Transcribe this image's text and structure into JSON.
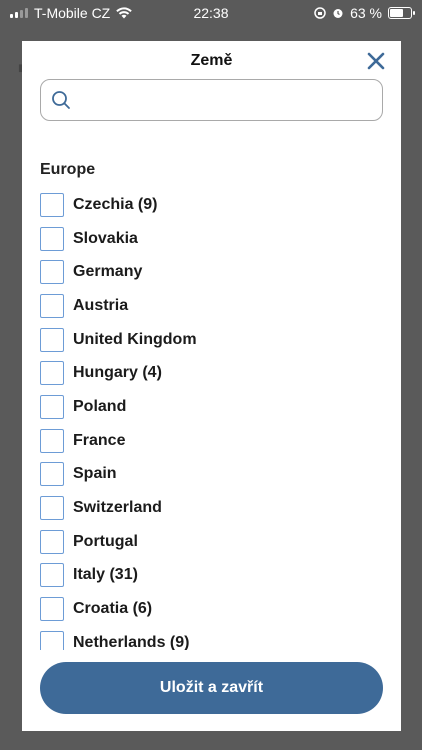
{
  "status_bar": {
    "carrier": "T-Mobile CZ",
    "time": "22:38",
    "battery": "63 %"
  },
  "modal": {
    "title": "Země",
    "search": {
      "placeholder": "",
      "value": ""
    },
    "section_label": "Europe",
    "items": [
      {
        "label": "Czechia (9)"
      },
      {
        "label": "Slovakia"
      },
      {
        "label": "Germany"
      },
      {
        "label": "Austria"
      },
      {
        "label": "United Kingdom"
      },
      {
        "label": "Hungary (4)"
      },
      {
        "label": "Poland"
      },
      {
        "label": "France"
      },
      {
        "label": "Spain"
      },
      {
        "label": "Switzerland"
      },
      {
        "label": "Portugal"
      },
      {
        "label": "Italy (31)"
      },
      {
        "label": "Croatia (6)"
      },
      {
        "label": "Netherlands (9)"
      }
    ],
    "save_label": "Uložit a zavřít"
  }
}
